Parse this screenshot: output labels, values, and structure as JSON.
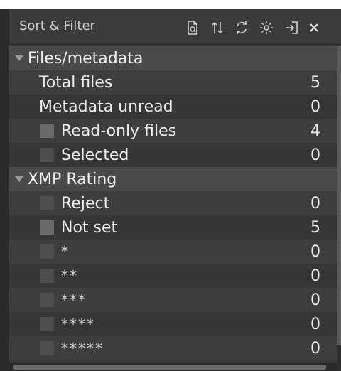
{
  "header": {
    "title": "Sort & Filter",
    "icons": [
      "search-document-icon",
      "sort-icon",
      "refresh-icon",
      "settings-icon",
      "export-icon",
      "close-icon"
    ]
  },
  "groups": [
    {
      "title": "Files/metadata",
      "rows": [
        {
          "label": "Total files",
          "count": "5",
          "checkbox": false
        },
        {
          "label": "Metadata unread",
          "count": "0",
          "checkbox": false
        },
        {
          "label": "Read-only files",
          "count": "4",
          "checkbox": true
        },
        {
          "label": "Selected",
          "count": "0",
          "checkbox": true
        }
      ]
    },
    {
      "title": "XMP Rating",
      "rows": [
        {
          "label": "Reject",
          "count": "0",
          "checkbox": true
        },
        {
          "label": "Not set",
          "count": "5",
          "checkbox": true
        },
        {
          "label": "*",
          "count": "0",
          "checkbox": true
        },
        {
          "label": "**",
          "count": "0",
          "checkbox": true
        },
        {
          "label": "***",
          "count": "0",
          "checkbox": true
        },
        {
          "label": "****",
          "count": "0",
          "checkbox": true
        },
        {
          "label": "*****",
          "count": "0",
          "checkbox": true
        }
      ]
    }
  ],
  "colors": {
    "panel": "#3a3a3a",
    "group": "#4a4a4a",
    "text": "#ececec"
  }
}
